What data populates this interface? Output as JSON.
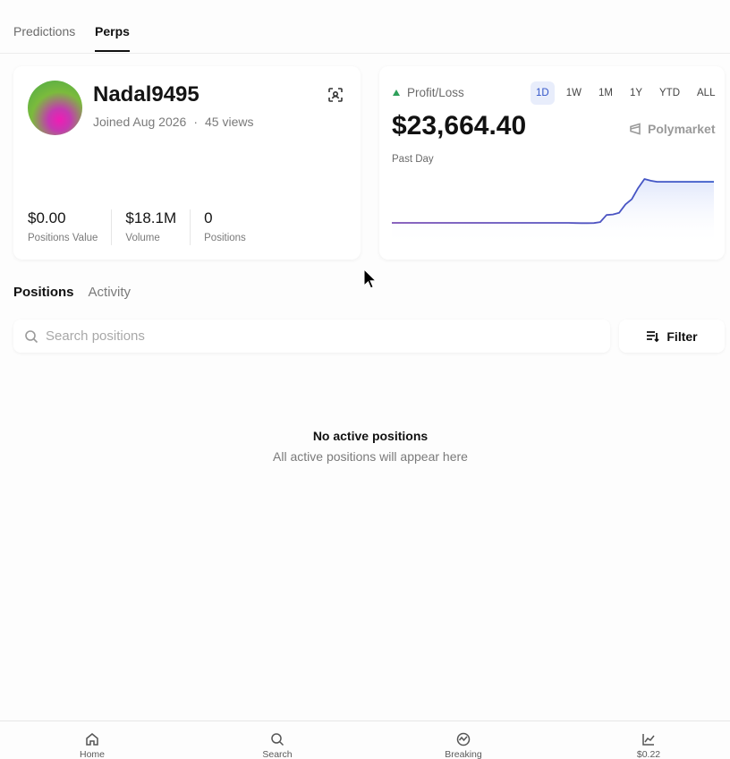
{
  "top_tabs": [
    {
      "label": "Predictions",
      "active": false
    },
    {
      "label": "Perps",
      "active": true
    }
  ],
  "profile": {
    "username": "Nadal9495",
    "joined": "Joined Aug 2026",
    "views": "45 views",
    "stats": [
      {
        "value": "$0.00",
        "label": "Positions Value"
      },
      {
        "value": "$18.1M",
        "label": "Volume"
      },
      {
        "value": "0",
        "label": "Positions"
      }
    ]
  },
  "pnl": {
    "label": "Profit/Loss",
    "value": "$23,664.40",
    "period": "Past Day",
    "brand": "Polymarket",
    "ranges": [
      "1D",
      "1W",
      "1M",
      "1Y",
      "YTD",
      "ALL"
    ],
    "active_range": "1D",
    "up_color": "#2ea05a"
  },
  "chart_data": {
    "type": "area",
    "title": "",
    "xlabel": "",
    "ylabel": "",
    "grid": false,
    "legend": "none",
    "line_color_start": "#7b4fb5",
    "line_color_end": "#3557c9",
    "fill_color": "#dfe6fb",
    "y_relative": [
      0,
      0,
      0,
      0,
      0,
      0,
      0,
      0,
      0,
      0,
      0,
      0,
      0,
      0,
      0,
      0,
      0,
      0,
      0,
      0,
      0,
      0,
      0,
      0,
      0,
      0,
      0,
      0,
      0,
      -0.3,
      -0.4,
      -0.4,
      -0.3,
      1.5,
      14,
      15,
      18,
      33,
      42,
      62,
      78,
      75,
      73,
      73,
      73,
      73,
      73,
      73,
      73,
      73,
      73,
      73
    ]
  },
  "sections": {
    "tabs": [
      {
        "label": "Positions",
        "active": true
      },
      {
        "label": "Activity",
        "active": false
      }
    ]
  },
  "search": {
    "placeholder": "Search positions",
    "value": ""
  },
  "filter": {
    "label": "Filter"
  },
  "empty_state": {
    "title": "No active positions",
    "subtitle": "All active positions will appear here"
  },
  "bottom_nav": [
    {
      "label": "Home",
      "icon": "home-icon"
    },
    {
      "label": "Search",
      "icon": "search-icon"
    },
    {
      "label": "Breaking",
      "icon": "breaking-icon"
    },
    {
      "label": "$0.22",
      "icon": "chart-icon"
    }
  ]
}
